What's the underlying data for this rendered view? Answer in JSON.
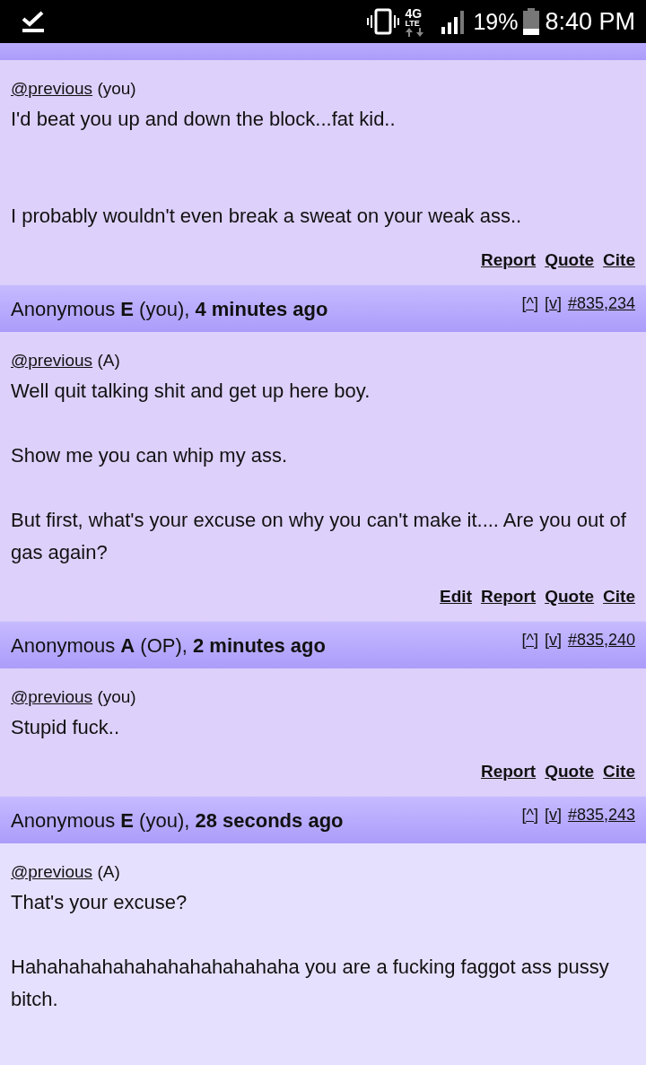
{
  "status_bar": {
    "network": "4G",
    "network_sub": "LTE",
    "battery": "19%",
    "time": "8:40 PM"
  },
  "posts": [
    {
      "reference": "@previous",
      "reference_note": "(you)",
      "message": "I'd beat you up and down the block...fat kid..\n\n\nI probably wouldn't even break a sweat on your weak ass..",
      "actions": [
        "Report",
        "Quote",
        "Cite"
      ],
      "highlighted": false
    },
    {
      "header": {
        "author": "Anonymous **E** (you), **4 minutes ago**",
        "links": [
          "[^]",
          "[v]",
          "#835,234"
        ]
      },
      "reference": "@previous",
      "reference_note": "(A)",
      "message": "Well quit talking shit and get up here boy.\n\nShow me you can whip my ass.\n\nBut first, what's your excuse on why you can't make it.... Are you out of gas again?",
      "actions": [
        "Edit",
        "Report",
        "Quote",
        "Cite"
      ],
      "highlighted": false
    },
    {
      "header": {
        "author": "Anonymous **A** (OP), **2 minutes ago**",
        "links": [
          "[^]",
          "[v]",
          "#835,240"
        ]
      },
      "reference": "@previous",
      "reference_note": "(you)",
      "message": "Stupid fuck..",
      "actions": [
        "Report",
        "Quote",
        "Cite"
      ],
      "highlighted": false
    },
    {
      "header": {
        "author": "Anonymous **E** (you), **28 seconds ago**",
        "links": [
          "[^]",
          "[v]",
          "#835,243"
        ]
      },
      "reference": "@previous",
      "reference_note": "(A)",
      "message": "That's your excuse?\n\nHahahahahahahahahahahahaha you are a fucking faggot ass pussy bitch.",
      "highlighted": true
    }
  ]
}
